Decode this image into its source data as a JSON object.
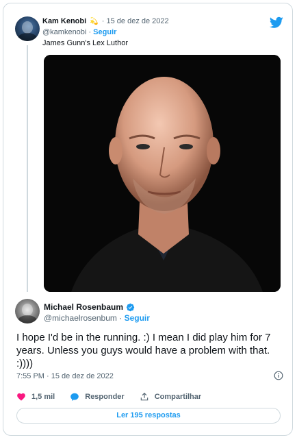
{
  "quoted_tweet": {
    "author_name": "Kam Kenobi",
    "author_emoji": "💫",
    "separator": "·",
    "date": "15 de dez de 2022",
    "handle": "@kamkenobi",
    "follow_label": "Seguir",
    "text": "James Gunn's Lex Luthor"
  },
  "reply_tweet": {
    "author_name": "Michael Rosenbaum",
    "handle": "@michaelrosenbum",
    "separator": "·",
    "follow_label": "Seguir",
    "text": "I hope I'd be in the running. :) I mean I did play him for 7 years. Unless you guys would have a problem with that. :))))",
    "timestamp": "7:55 PM · 15 de dez de 2022"
  },
  "actions": {
    "like_count": "1,5 mil",
    "reply_label": "Responder",
    "share_label": "Compartilhar"
  },
  "read_replies_label": "Ler 195 respostas",
  "colors": {
    "accent": "#1d9bf0",
    "like": "#f91880",
    "text": "#0f1419",
    "muted": "#536471",
    "border": "#cfd9de"
  },
  "icons": [
    "twitter-bird-icon",
    "verified-badge-icon",
    "info-icon",
    "heart-icon",
    "reply-bubble-icon",
    "share-icon"
  ]
}
